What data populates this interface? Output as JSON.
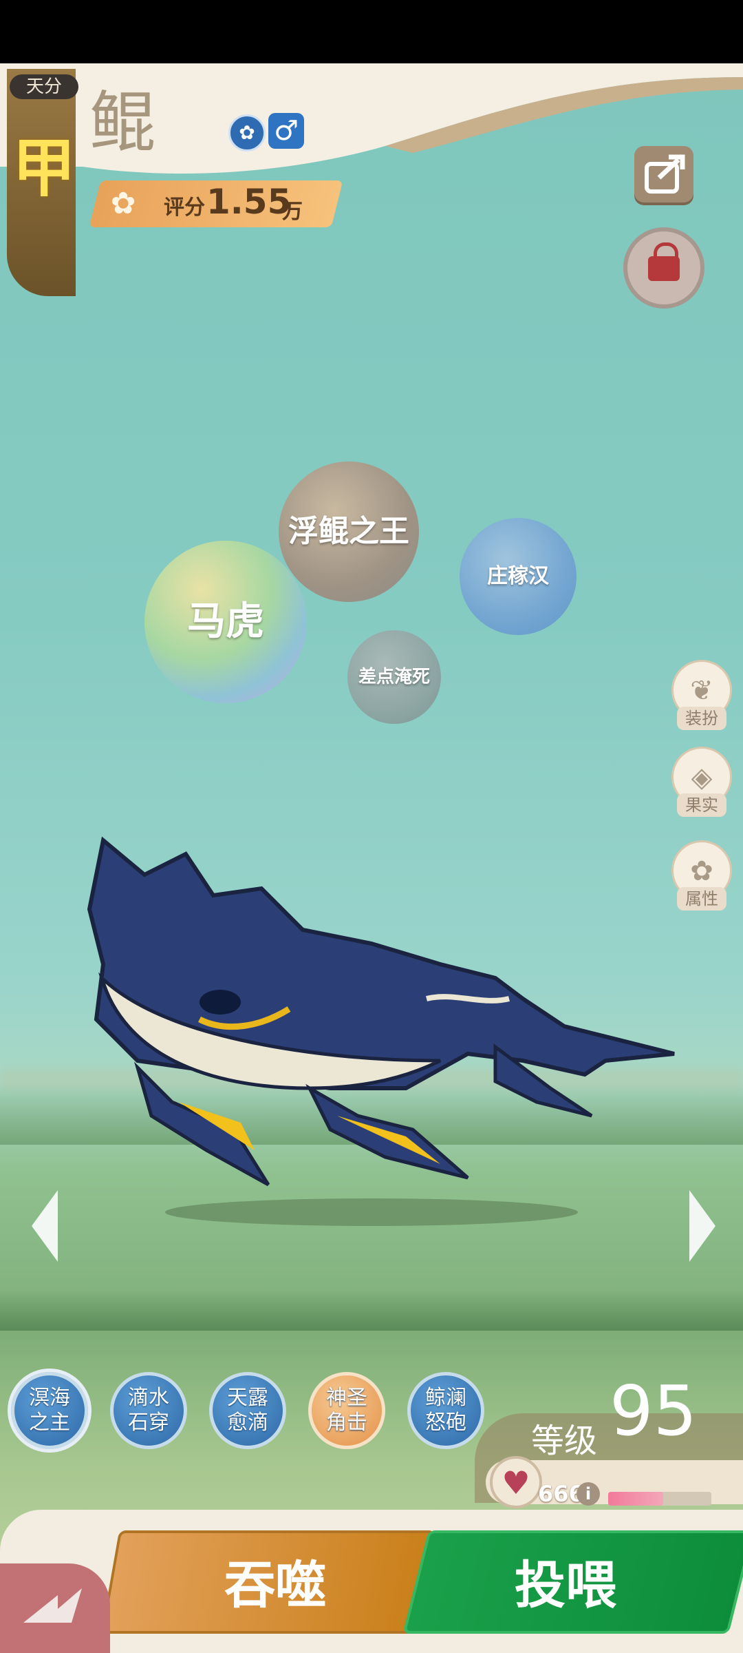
{
  "header": {
    "talent_label": "天分",
    "talent_grade": "甲",
    "pet_name": "鲲",
    "element_icon": "water-element-icon",
    "gender_symbol": "♂",
    "score_label": "评分",
    "score_value": "1.55",
    "score_unit": "万"
  },
  "bubbles": [
    {
      "text": "浮鲲之王"
    },
    {
      "text": "马虎"
    },
    {
      "text": "庄稼汉"
    },
    {
      "text": "差点淹死"
    }
  ],
  "side_menu": [
    {
      "label": "装扮",
      "icon": "butterfly-icon"
    },
    {
      "label": "果实",
      "icon": "fruit-icon"
    },
    {
      "label": "属性",
      "icon": "paw-icon"
    }
  ],
  "skills": [
    {
      "text": "溟海之主"
    },
    {
      "text": "滴水石穿"
    },
    {
      "text": "天露愈滴"
    },
    {
      "text": "神圣角击"
    },
    {
      "text": "鲸澜怒砲"
    }
  ],
  "level": {
    "label": "等级",
    "value": "95"
  },
  "experience": {
    "value": "666",
    "progress": 0.53
  },
  "actions": {
    "devour_label": "吞噬",
    "feed_label": "投喂"
  },
  "colors": {
    "devour": "#d68a2e",
    "feed": "#159a45",
    "grade": "#ffe35a"
  }
}
